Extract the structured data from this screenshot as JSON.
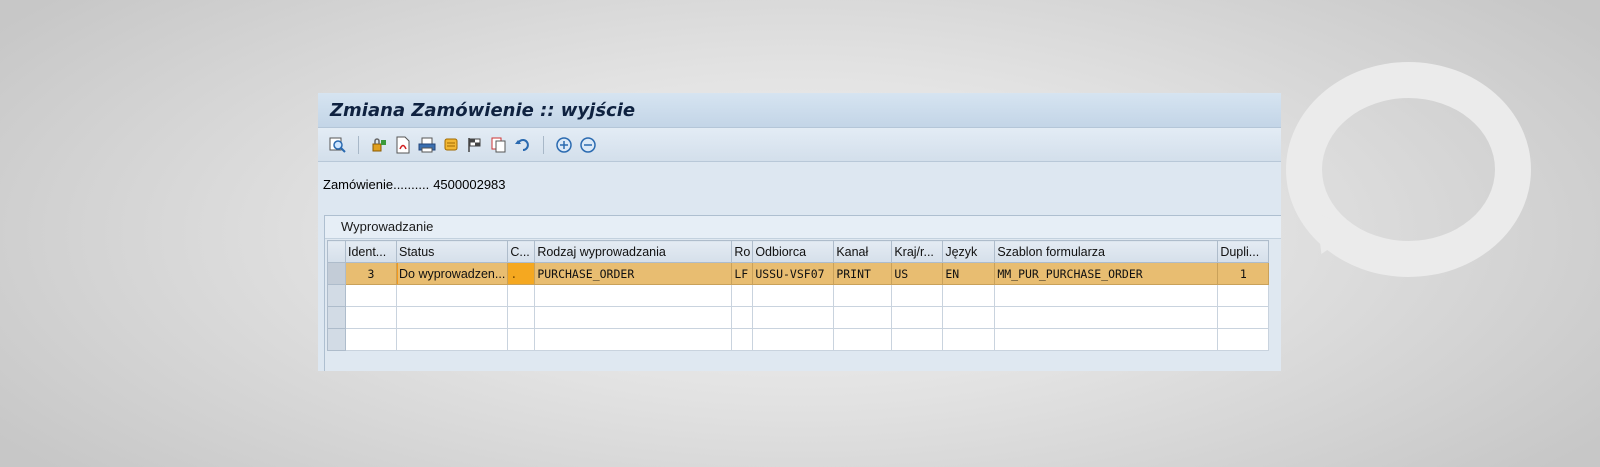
{
  "window": {
    "title": "Zmiana Zamówienie :: wyjście"
  },
  "toolbar": {
    "icons": [
      "display-details-icon",
      "lock-icon",
      "pdf-icon",
      "print-preview-icon",
      "scroll-icon",
      "flag-icon",
      "copy-icon",
      "undo-icon",
      "zoom-in-icon",
      "zoom-out-icon"
    ]
  },
  "order": {
    "label": "Zamówienie..........",
    "number": "4500002983"
  },
  "panel": {
    "title": "Wyprowadzanie"
  },
  "table": {
    "headers": [
      "Ident...",
      "Status",
      "C...",
      "Rodzaj wyprowadzania",
      "Ro",
      "Odbiorca",
      "Kanał",
      "Kraj/r...",
      "Język",
      "Szablon formularza",
      "Dupli..."
    ],
    "rows": [
      {
        "id": "3",
        "status": "Do wyprowadzen...",
        "c": ".",
        "type": "PURCHASE_ORDER",
        "ro": "LF",
        "recipient": "USSU-VSF07",
        "channel": "PRINT",
        "country": "US",
        "language": "EN",
        "template": "MM_PUR_PURCHASE_ORDER",
        "duplicates": "1"
      }
    ],
    "empty_rows": 3
  },
  "colors": {
    "selected_row": "#e8bd71",
    "highlight_start": "#f59a1c",
    "highlight_end": "#e31f1f",
    "title_bar": "#c8d9ea"
  }
}
